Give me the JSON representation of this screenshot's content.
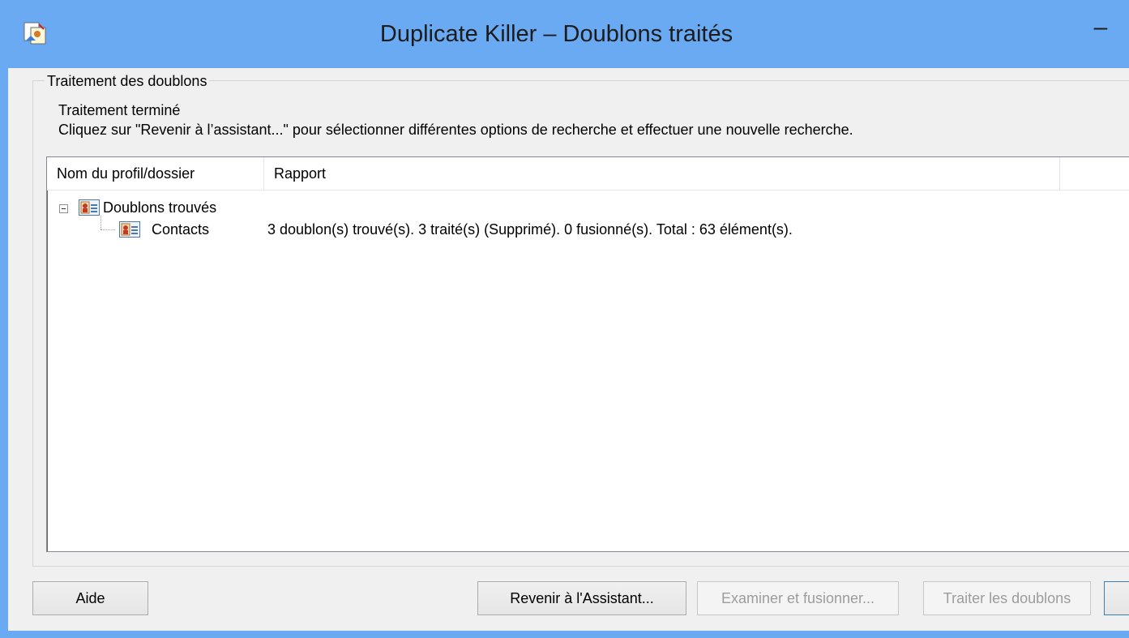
{
  "window": {
    "title": "Duplicate Killer – Doublons traités",
    "minimize_glyph": "–"
  },
  "group": {
    "label": "Traitement des doublons",
    "status": "Traitement terminé",
    "instruction": "Cliquez sur \"Revenir à l’assistant...\" pour sélectionner différentes options de recherche et effectuer une nouvelle recherche."
  },
  "list": {
    "columns": [
      "Nom du profil/dossier",
      "Rapport",
      ""
    ],
    "rows": [
      {
        "name": "Doublons trouvés",
        "report": "",
        "icon": "contact-card-icon",
        "expanded": true
      },
      {
        "name": "Contacts",
        "report": "3 doublon(s) trouvé(s). 3 traité(s) (Supprimé). 0 fusionné(s). Total : 63 élément(s).",
        "icon": "contact-card-icon"
      }
    ]
  },
  "buttons": {
    "help": "Aide",
    "back": "Revenir à l'Assistant...",
    "review": "Examiner et fusionner...",
    "process": "Traiter les doublons",
    "finish": ""
  },
  "colors": {
    "titlebar": "#6aaaf3",
    "client": "#f0f0f0",
    "disabled_text": "#9c9c9c"
  }
}
